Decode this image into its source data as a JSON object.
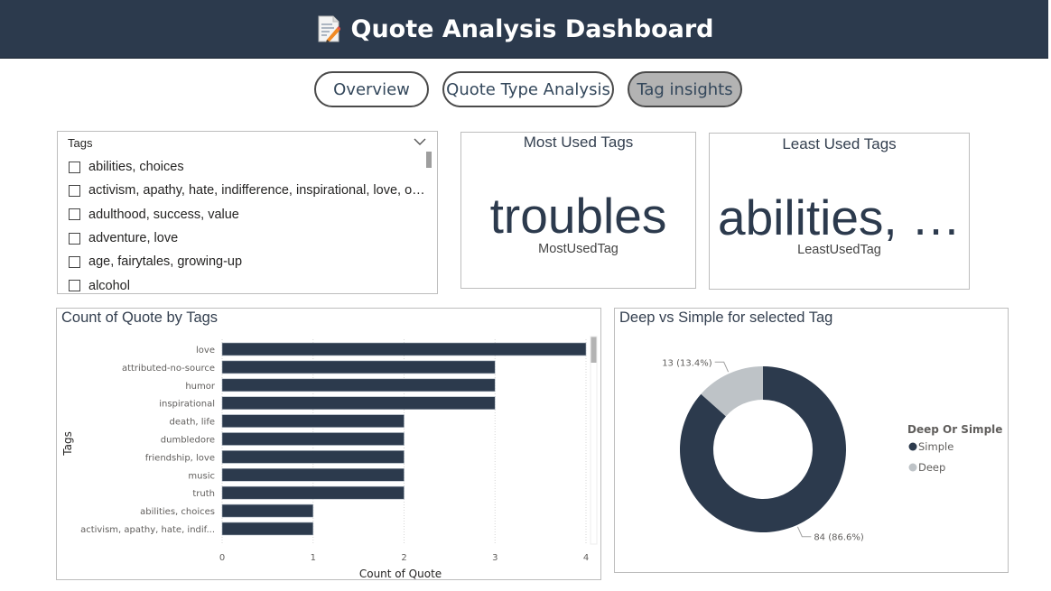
{
  "header": {
    "title": "Quote Analysis Dashboard",
    "icon": "memo-icon"
  },
  "nav": {
    "overview": "Overview",
    "quote_type": "Quote Type Analysis",
    "tag_insights": "Tag insights",
    "active": "Tag insights"
  },
  "slicer": {
    "title": "Tags",
    "items": [
      "abilities, choices",
      "activism, apathy, hate, indifference, inspirational, love, op...",
      "adulthood, success, value",
      "adventure, love",
      "age, fairytales, growing-up",
      "alcohol"
    ]
  },
  "most_used": {
    "title": "Most Used Tags",
    "value": "troubles",
    "label": "MostUsedTag"
  },
  "least_used": {
    "title": "Least Used Tags",
    "value": "abilities, …",
    "label": "LeastUsedTag"
  },
  "colors": {
    "header": "#2c3a4d",
    "bar": "#2c3a4d",
    "simple": "#2c3a4d",
    "deep": "#bec3c7"
  },
  "chart_data": [
    {
      "type": "bar",
      "orientation": "horizontal",
      "title": "Count of Quote by Tags",
      "xlabel": "Count of Quote",
      "ylabel": "Tags",
      "categories": [
        "love",
        "attributed-no-source",
        "humor",
        "inspirational",
        "death, life",
        "dumbledore",
        "friendship, love",
        "music",
        "truth",
        "abilities, choices",
        "activism, apathy, hate, indif..."
      ],
      "values": [
        4,
        3,
        3,
        3,
        2,
        2,
        2,
        2,
        2,
        1,
        1
      ],
      "xlim": [
        0,
        4
      ],
      "xticks": [
        "0",
        "1",
        "2",
        "3",
        "4"
      ],
      "grid": true
    },
    {
      "type": "pie",
      "variant": "donut",
      "title": "Deep vs Simple for selected Tag",
      "legend_title": "Deep Or Simple",
      "legend_position": "right",
      "slices": [
        {
          "name": "Simple",
          "value": 84,
          "label": "84 (86.6%)"
        },
        {
          "name": "Deep",
          "value": 13,
          "label": "13 (13.4%)"
        }
      ]
    }
  ]
}
